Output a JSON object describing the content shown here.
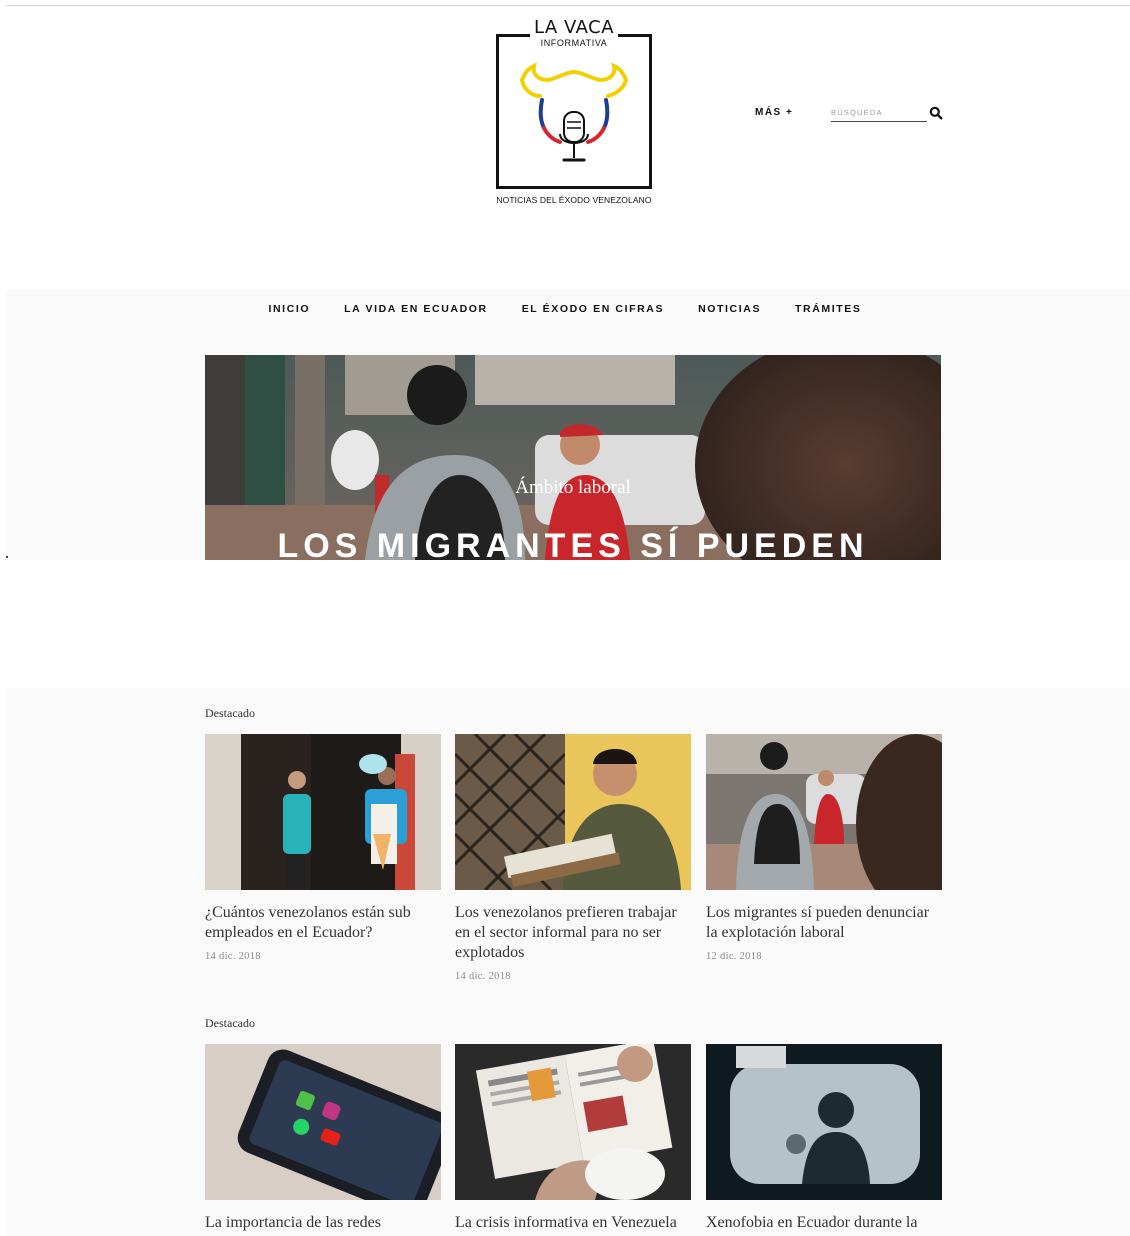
{
  "brand": {
    "title": "LA VACA",
    "subtitle": "INFORMATIVA",
    "tagline": "NOTICIAS DEL ÉXODO VENEZOLANO"
  },
  "header": {
    "more_label": "MÁS +",
    "search_placeholder": "BÚSQUEDA"
  },
  "nav": {
    "items": [
      {
        "label": "INICIO"
      },
      {
        "label": "LA VIDA EN ECUADOR"
      },
      {
        "label": "EL ÉXODO EN CIFRAS"
      },
      {
        "label": "NOTICIAS"
      },
      {
        "label": "TRÁMITES"
      }
    ]
  },
  "hero": {
    "kicker": "Ámbito laboral",
    "title": "LOS MIGRANTES SÍ PUEDEN"
  },
  "sections": [
    {
      "label": "Destacado",
      "cards": [
        {
          "title": "¿Cuántos venezolanos están sub empleados en el Ecuador?",
          "date": "14 dic. 2018"
        },
        {
          "title": "Los venezolanos prefieren trabajar en el sector informal para no ser explotados",
          "date": "14 dic. 2018"
        },
        {
          "title": "Los migrantes sí pueden denunciar la explotación laboral",
          "date": "12 dic. 2018"
        }
      ]
    },
    {
      "label": "Destacado",
      "cards": [
        {
          "title": "La importancia de las redes",
          "date": ""
        },
        {
          "title": "La crisis informativa en Venezuela",
          "date": ""
        },
        {
          "title": "Xenofobia en Ecuador durante la",
          "date": ""
        }
      ]
    }
  ],
  "colors": {
    "band_bg": "#fafafa",
    "text_dark": "#111111",
    "meta_gray": "#8a8a8a",
    "flag_yellow": "#f2d000",
    "flag_blue": "#1c3f94",
    "flag_red": "#d7262e"
  }
}
